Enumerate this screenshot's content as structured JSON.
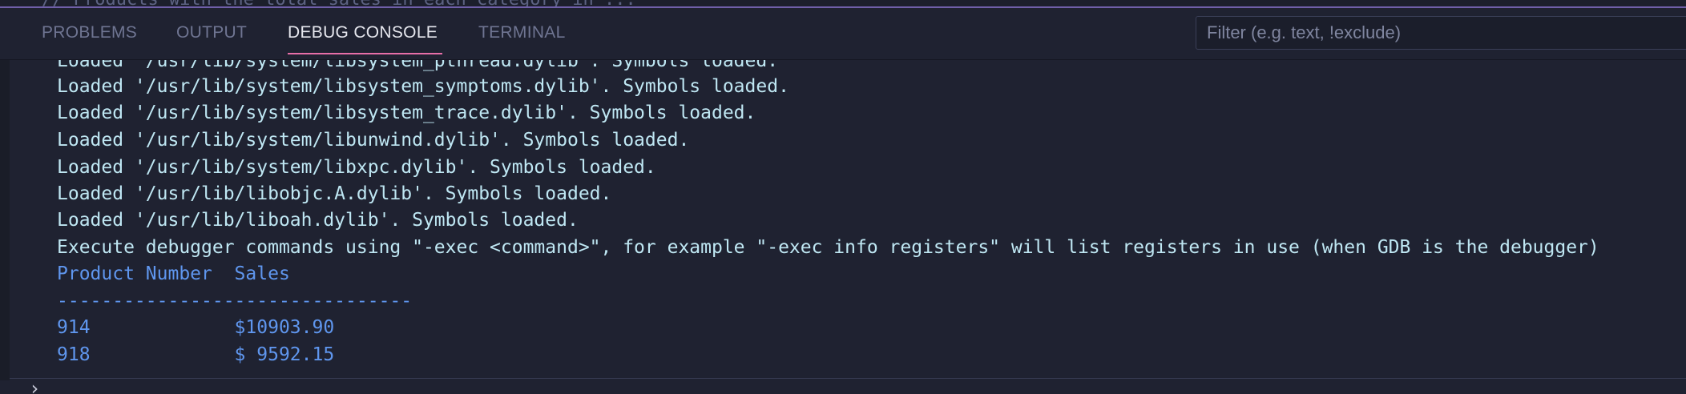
{
  "editor_peek": "        // Products with the total sales in each category in ...",
  "tabs": [
    {
      "label": "PROBLEMS",
      "active": false
    },
    {
      "label": "OUTPUT",
      "active": false
    },
    {
      "label": "DEBUG CONSOLE",
      "active": true
    },
    {
      "label": "TERMINAL",
      "active": false
    }
  ],
  "filter": {
    "placeholder": "Filter (e.g. text, !exclude)",
    "value": ""
  },
  "console": {
    "lines": [
      "Loaded '/usr/lib/system/libsystem_pthread.dylib'. Symbols loaded.",
      "Loaded '/usr/lib/system/libsystem_symptoms.dylib'. Symbols loaded.",
      "Loaded '/usr/lib/system/libsystem_trace.dylib'. Symbols loaded.",
      "Loaded '/usr/lib/system/libunwind.dylib'. Symbols loaded.",
      "Loaded '/usr/lib/system/libxpc.dylib'. Symbols loaded.",
      "Loaded '/usr/lib/libobjc.A.dylib'. Symbols loaded.",
      "Loaded '/usr/lib/liboah.dylib'. Symbols loaded.",
      "Execute debugger commands using \"-exec <command>\", for example \"-exec info registers\" will list registers in use (when GDB is the debugger)"
    ],
    "program_output": {
      "header": "Product Number  Sales",
      "separator": "--------------------------------",
      "rows": [
        "914             $10903.90",
        "918             $ 9592.15"
      ]
    }
  },
  "repl": {
    "prompt_icon": "chevron-right-icon",
    "prompt_glyph": "›"
  },
  "colors": {
    "background": "#1f2231",
    "log_text": "#bfe7f3",
    "program_output_text": "#5f96ee",
    "active_tab_underline": "#e86fa8",
    "panel_border": "#6f5fa8"
  }
}
